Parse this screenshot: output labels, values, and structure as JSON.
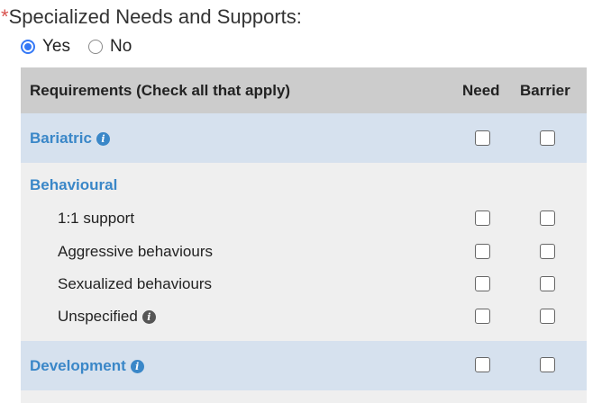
{
  "question": {
    "required_marker": "*",
    "label": "Specialized Needs and Supports:"
  },
  "radio": {
    "options": [
      {
        "label": "Yes",
        "selected": true
      },
      {
        "label": "No",
        "selected": false
      }
    ]
  },
  "table": {
    "headers": {
      "requirements": "Requirements (Check all that apply)",
      "need": "Need",
      "barrier": "Barrier"
    },
    "categories": [
      {
        "label": "Bariatric",
        "info_icon": "info-icon"
      },
      {
        "label": "Behavioural",
        "items": [
          {
            "label": "1:1 support"
          },
          {
            "label": "Aggressive behaviours"
          },
          {
            "label": "Sexualized behaviours"
          },
          {
            "label": "Unspecified",
            "info_icon": "info-icon"
          }
        ]
      },
      {
        "label": "Development",
        "info_icon": "info-icon"
      }
    ]
  },
  "colors": {
    "accent": "#3a87c8",
    "header_bg": "#cccccc",
    "category_bg": "#d6e1ee",
    "group_bg": "#efefef",
    "required": "#d9534f",
    "radio_selected": "#3478f6"
  }
}
